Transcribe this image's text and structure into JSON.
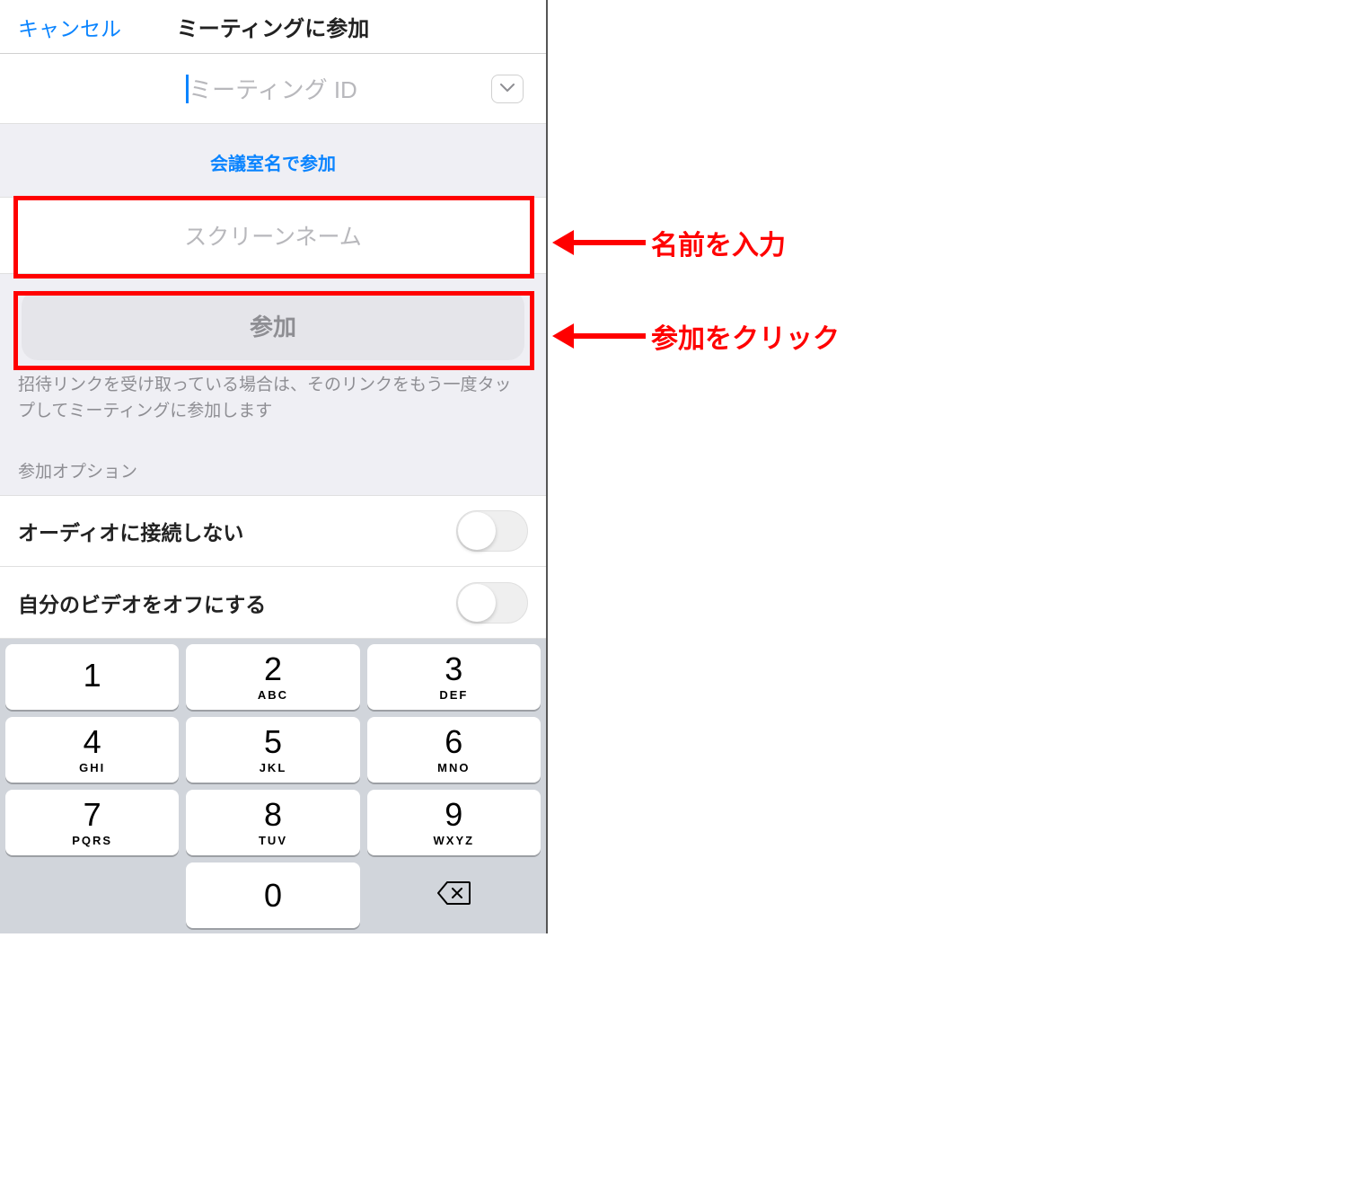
{
  "navbar": {
    "cancel": "キャンセル",
    "title": "ミーティングに参加"
  },
  "meeting_id": {
    "placeholder": "ミーティング ID"
  },
  "join_by_room_link": "会議室名で参加",
  "screen_name": {
    "placeholder": "スクリーンネーム"
  },
  "join_button": "参加",
  "invite_hint": "招待リンクを受け取っている場合は、そのリンクをもう一度タップしてミーティングに参加します",
  "options_header": "参加オプション",
  "options": {
    "audio_off": "オーディオに接続しない",
    "video_off": "自分のビデオをオフにする"
  },
  "keypad": {
    "k1": {
      "d": "1",
      "l": ""
    },
    "k2": {
      "d": "2",
      "l": "ABC"
    },
    "k3": {
      "d": "3",
      "l": "DEF"
    },
    "k4": {
      "d": "4",
      "l": "GHI"
    },
    "k5": {
      "d": "5",
      "l": "JKL"
    },
    "k6": {
      "d": "6",
      "l": "MNO"
    },
    "k7": {
      "d": "7",
      "l": "PQRS"
    },
    "k8": {
      "d": "8",
      "l": "TUV"
    },
    "k9": {
      "d": "9",
      "l": "WXYZ"
    },
    "k0": {
      "d": "0",
      "l": ""
    }
  },
  "annotations": {
    "name": "名前を入力",
    "join": "参加をクリック"
  },
  "colors": {
    "accent": "#0a84ff",
    "highlight": "#ff0000",
    "disabled": "#8e8e93"
  }
}
